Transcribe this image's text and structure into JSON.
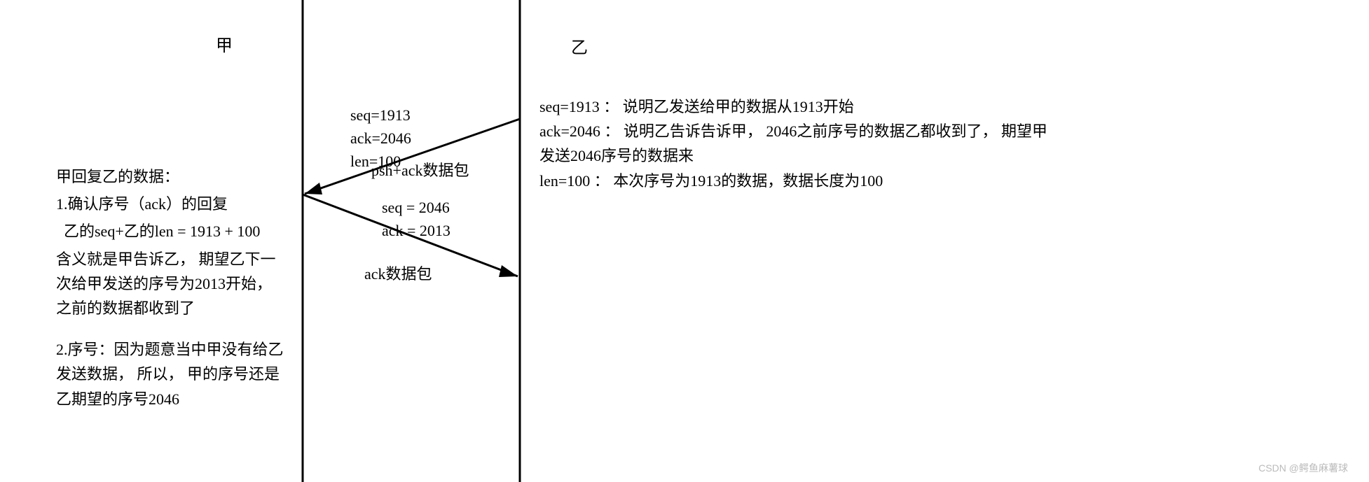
{
  "header": {
    "left_party": "甲",
    "right_party": "乙"
  },
  "left_notes": {
    "title": "甲回复乙的数据：",
    "line1": "1.确认序号（ack）的回复",
    "line2": "  乙的seq+乙的len = 1913 + 100",
    "line3": "含义就是甲告诉乙， 期望乙下一次给甲发送的序号为2013开始， 之前的数据都收到了",
    "line4": "2.序号：因为题意当中甲没有给乙发送数据， 所以， 甲的序号还是乙期望的序号2046"
  },
  "right_notes": {
    "line1": "seq=1913 ： 说明乙发送给甲的数据从1913开始",
    "line2": "ack=2046 ： 说明乙告诉告诉甲， 2046之前序号的数据乙都收到了， 期望甲发送2046序号的数据来",
    "line3": "len=100 ： 本次序号为1913的数据，数据长度为100"
  },
  "packets": {
    "incoming": {
      "seq": "seq=1913",
      "ack": "ack=2046",
      "len": "len=100",
      "type": "psh+ack数据包"
    },
    "outgoing": {
      "seq": "seq = 2046",
      "ack": "ack = 2013",
      "type": "ack数据包"
    }
  },
  "watermark": "CSDN @鳄鱼麻薯球"
}
